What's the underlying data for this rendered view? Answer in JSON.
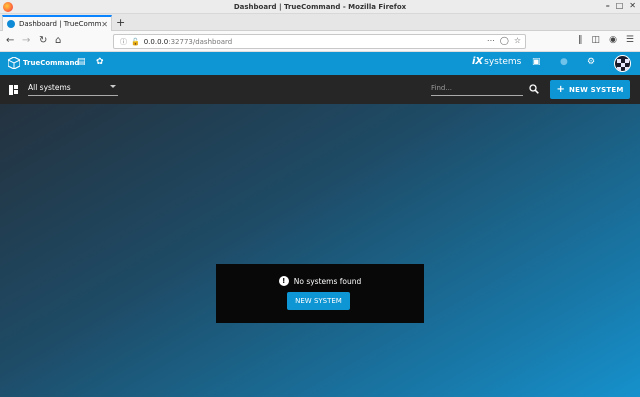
{
  "window": {
    "title": "Dashboard | TrueCommand - Mozilla Firefox"
  },
  "browser": {
    "tab_title": "Dashboard | TrueCommand",
    "new_tab_label": "+",
    "url_host": "0.0.0.0",
    "url_rest": ":32773/dashboard"
  },
  "app": {
    "brand": "TrueCommand",
    "vendor": "systems",
    "vendor_mark": "iX",
    "accent_color": "#0e95d3",
    "toolbar_color": "#262626"
  },
  "toolbar": {
    "system_select_value": "All systems",
    "find_placeholder": "Find...",
    "new_system_label": "NEW SYSTEM",
    "new_system_prefix": "+"
  },
  "main": {
    "empty_message": "No systems found",
    "empty_button_label": "NEW SYSTEM",
    "info_icon_glyph": "!"
  },
  "icons": {
    "back": "back-arrow-icon",
    "forward": "forward-arrow-icon",
    "reload": "reload-icon",
    "home": "home-icon",
    "gallery": "image-icon",
    "palette": "palette-icon",
    "news": "news-icon",
    "alerts": "bell-icon",
    "settings": "gear-icon",
    "dashboard": "grid-icon",
    "search": "search-icon"
  }
}
